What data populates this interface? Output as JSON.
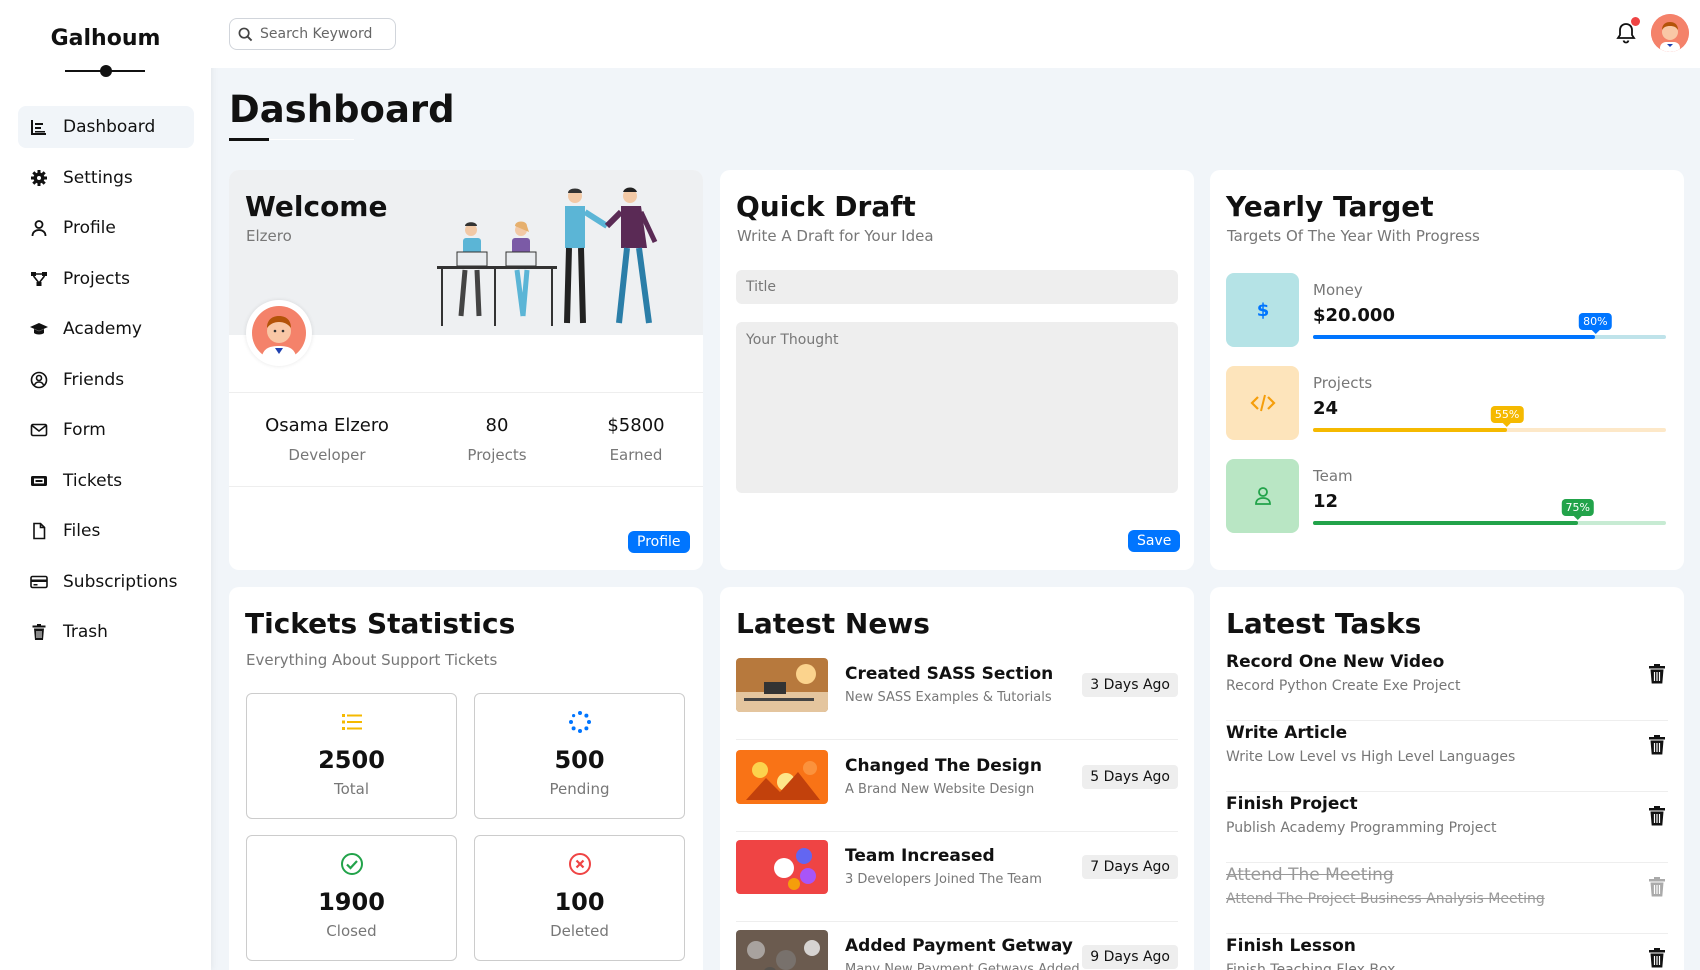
{
  "brand": "Galhoum",
  "sidebar": {
    "items": [
      {
        "label": "Dashboard",
        "icon": "chart-icon"
      },
      {
        "label": "Settings",
        "icon": "gear-icon"
      },
      {
        "label": "Profile",
        "icon": "user-icon"
      },
      {
        "label": "Projects",
        "icon": "diagram-icon"
      },
      {
        "label": "Academy",
        "icon": "graduation-cap-icon"
      },
      {
        "label": "Friends",
        "icon": "user-circle-icon"
      },
      {
        "label": "Form",
        "icon": "envelope-icon"
      },
      {
        "label": "Tickets",
        "icon": "ticket-icon"
      },
      {
        "label": "Files",
        "icon": "file-icon"
      },
      {
        "label": "Subscriptions",
        "icon": "credit-card-icon"
      },
      {
        "label": "Trash",
        "icon": "trash-icon"
      }
    ]
  },
  "header": {
    "search_placeholder": "Search Keyword"
  },
  "page_title": "Dashboard",
  "welcome": {
    "title": "Welcome",
    "subtitle": "Elzero",
    "name": "Osama Elzero",
    "role": "Developer",
    "projects_value": "80",
    "projects_label": "Projects",
    "earned_value": "$5800",
    "earned_label": "Earned",
    "button": "Profile"
  },
  "draft": {
    "title": "Quick Draft",
    "subtitle": "Write A Draft for Your Idea",
    "title_placeholder": "Title",
    "thought_placeholder": "Your Thought",
    "button": "Save"
  },
  "target": {
    "title": "Yearly Target",
    "subtitle": "Targets Of The Year With Progress",
    "items": [
      {
        "label": "Money",
        "value": "$20.000",
        "percent": 80,
        "percent_label": "80%",
        "color": "#0075ff",
        "track": "#bfe3ea",
        "iconbg": "#b5e3e6",
        "icon": "dollar-icon"
      },
      {
        "label": "Projects",
        "value": "24",
        "percent": 55,
        "percent_label": "55%",
        "color": "#f59e0b",
        "track": "#fde8c8",
        "iconbg": "#fde4bb",
        "icon": "code-icon"
      },
      {
        "label": "Team",
        "value": "12",
        "percent": 75,
        "percent_label": "75%",
        "color": "#22a34a",
        "track": "#c7ebd3",
        "iconbg": "#b9e6c4",
        "icon": "user-icon"
      }
    ]
  },
  "tickets": {
    "title": "Tickets Statistics",
    "subtitle": "Everything About Support Tickets",
    "items": [
      {
        "number": "2500",
        "label": "Total"
      },
      {
        "number": "500",
        "label": "Pending"
      },
      {
        "number": "1900",
        "label": "Closed"
      },
      {
        "number": "100",
        "label": "Deleted"
      }
    ]
  },
  "news": {
    "title": "Latest News",
    "items": [
      {
        "title": "Created SASS Section",
        "desc": "New SASS Examples & Tutorials",
        "time": "3 Days Ago"
      },
      {
        "title": "Changed The Design",
        "desc": "A Brand New Website Design",
        "time": "5 Days Ago"
      },
      {
        "title": "Team Increased",
        "desc": "3 Developers Joined The Team",
        "time": "7 Days Ago"
      },
      {
        "title": "Added Payment Getway",
        "desc": "Many New Payment Getways Added",
        "time": "9 Days Ago"
      }
    ]
  },
  "tasks": {
    "title": "Latest Tasks",
    "items": [
      {
        "title": "Record One New Video",
        "desc": "Record Python Create Exe Project"
      },
      {
        "title": "Write Article",
        "desc": "Write Low Level vs High Level Languages"
      },
      {
        "title": "Finish Project",
        "desc": "Publish Academy Programming Project"
      },
      {
        "title": "Attend The Meeting",
        "desc": "Attend The Project Business Analysis Meeting"
      },
      {
        "title": "Finish Lesson",
        "desc": "Finish Teaching Flex Box"
      }
    ]
  }
}
